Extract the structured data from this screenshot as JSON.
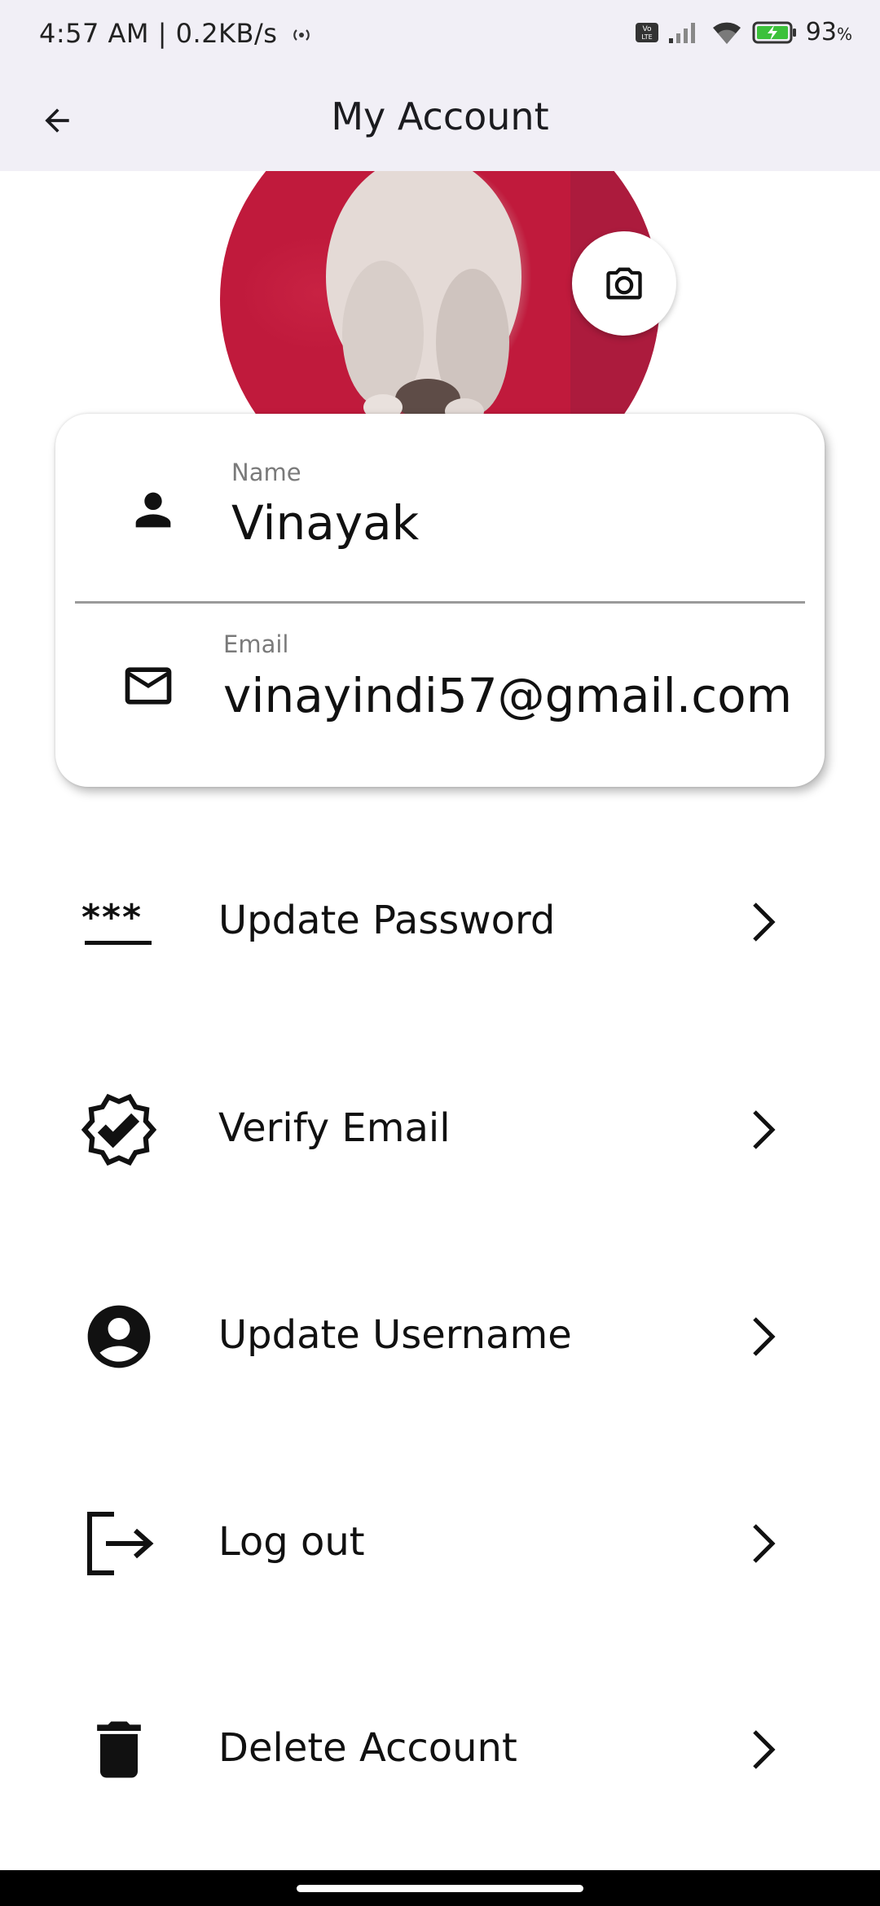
{
  "status_bar": {
    "time": "4:57 AM | 0.2KB/s",
    "battery_percent": "93",
    "battery_unit": "%"
  },
  "app_bar": {
    "title": "My Account",
    "back_icon": "arrow-left-icon"
  },
  "profile": {
    "avatar_icon": "profile-photo",
    "camera_icon": "camera-icon"
  },
  "account_card": {
    "name": {
      "label": "Name",
      "value": "Vinayak",
      "icon": "person-icon"
    },
    "email": {
      "label": "Email",
      "value": "vinayindi57@gmail.com",
      "icon": "mail-icon"
    }
  },
  "menu": {
    "items": [
      {
        "label": "Update Password",
        "icon": "password-icon"
      },
      {
        "label": "Verify Email",
        "icon": "verified-badge-icon"
      },
      {
        "label": "Update Username",
        "icon": "account-circle-icon"
      },
      {
        "label": "Log out",
        "icon": "logout-icon"
      },
      {
        "label": "Delete Account",
        "icon": "trash-icon"
      }
    ]
  },
  "colors": {
    "app_bar_bg": "#f1eff6",
    "card_bg": "#ffffff",
    "text": "#111111"
  }
}
